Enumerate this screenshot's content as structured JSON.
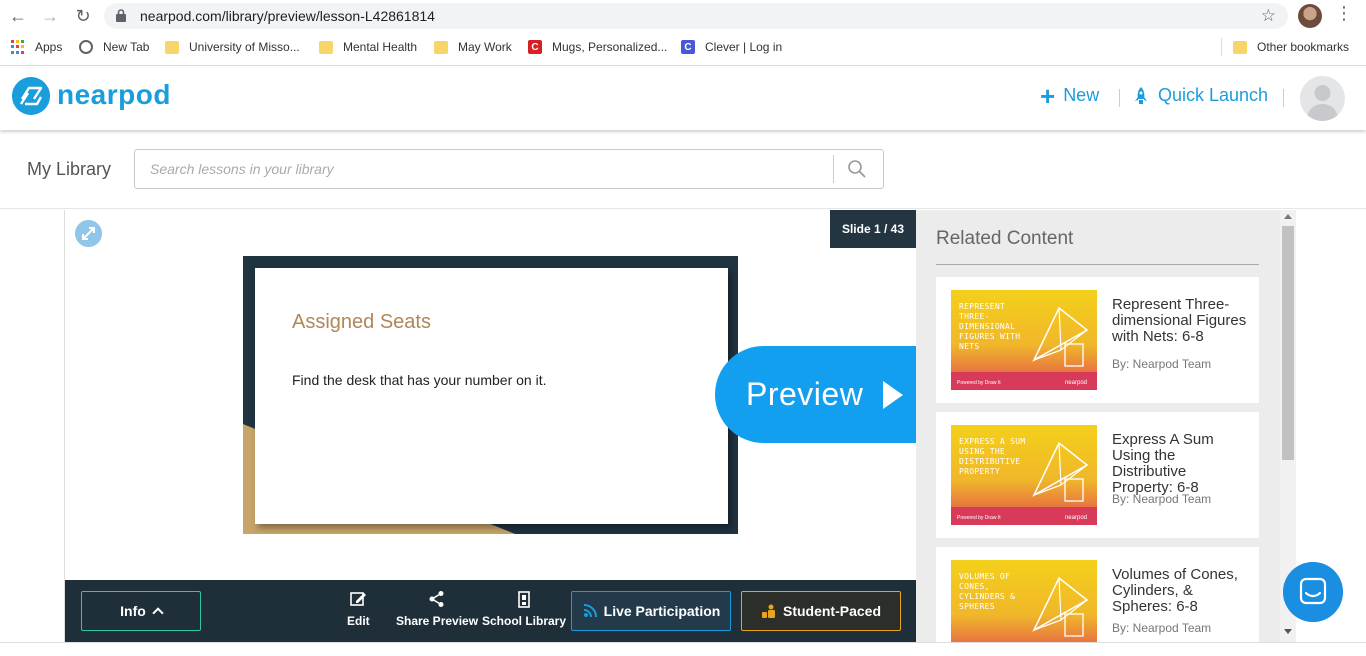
{
  "browser": {
    "url": "nearpod.com/library/preview/lesson-L42861814",
    "bookmarks": [
      {
        "label": "Apps",
        "icon": "apps-grid-icon"
      },
      {
        "label": "New Tab",
        "icon": "globe-icon"
      },
      {
        "label": "University of Misso...",
        "icon": "folder-icon"
      },
      {
        "label": "Mental Health",
        "icon": "folder-icon"
      },
      {
        "label": "May Work",
        "icon": "folder-icon"
      },
      {
        "label": "Mugs, Personalized...",
        "icon": "c-icon"
      },
      {
        "label": "Clever | Log in",
        "icon": "clever-icon"
      }
    ],
    "other_bookmarks": "Other bookmarks"
  },
  "header": {
    "logo": "nearpod",
    "new_label": "New",
    "quick_launch_label": "Quick Launch"
  },
  "library": {
    "title": "My Library",
    "search_placeholder": "Search lessons in your library"
  },
  "preview": {
    "slide_counter": "Slide 1 / 43",
    "slide_title": "Assigned Seats",
    "slide_text": "Find the desk that has your number on it.",
    "preview_label": "Preview"
  },
  "toolbar": {
    "info_label": "Info",
    "edit_label": "Edit",
    "share_label": "Share Preview",
    "school_library_label": "School Library",
    "live_label": "Live Participation",
    "student_paced_label": "Student-Paced"
  },
  "related": {
    "title": "Related Content",
    "items": [
      {
        "thumb_text": "Represent Three-Dimensional Figures with Nets",
        "title": "Represent Three-dimensional Figures with Nets: 6-8",
        "author": "By: Nearpod Team"
      },
      {
        "thumb_text": "Express A Sum Using the Distributive Property",
        "title": "Express A Sum Using the Distributive Property: 6-8",
        "author": "By: Nearpod Team"
      },
      {
        "thumb_text": "Volumes of Cones, Cylinders & Spheres",
        "title": "Volumes of Cones, Cylinders, & Spheres: 6-8",
        "author": "By: Nearpod Team"
      }
    ],
    "thumb_footer_left": "Powered by Draw It",
    "thumb_footer_right": "nearpod"
  },
  "colors": {
    "brand": "#1a9ddc",
    "bottom_bar": "#1f2f3a",
    "live_accent": "#1a9ddc",
    "student_paced_accent": "#e8a320",
    "info_accent": "#2ec7a5"
  }
}
